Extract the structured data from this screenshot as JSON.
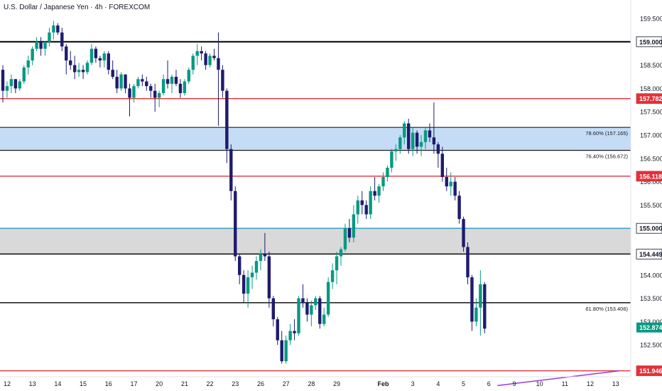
{
  "header": {
    "title": "U.S. Dollar / Japanese Yen · 4h · FOREXCOM"
  },
  "colors": {
    "up": "#089981",
    "down": "#1e1b6e",
    "support_red": "#e0313a",
    "black": "#000000",
    "fib_zone": "#c5dcf6",
    "fib_zone_border": "#1f1f1f",
    "gray_zone": "#d9d9d9",
    "gray_zone_top": "#2a9bb8",
    "trend": "#9b3be0",
    "price_tag": "#089981",
    "axis_text": "#131722"
  },
  "chart_data": {
    "type": "candlestick",
    "timeframe": "4h",
    "instrument": "USDJPY",
    "ylim": [
      151.93,
      159.75
    ],
    "y_ticks": [
      "159.500",
      "159.000",
      "158.500",
      "158.000",
      "157.500",
      "157.000",
      "156.500",
      "156.000",
      "155.500",
      "155.000",
      "154.500",
      "154.000",
      "153.500",
      "153.000",
      "152.500"
    ],
    "x_ticks": [
      {
        "label": "12",
        "idx": 1
      },
      {
        "label": "13",
        "idx": 7
      },
      {
        "label": "14",
        "idx": 13
      },
      {
        "label": "15",
        "idx": 19
      },
      {
        "label": "16",
        "idx": 25
      },
      {
        "label": "17",
        "idx": 31
      },
      {
        "label": "20",
        "idx": 37
      },
      {
        "label": "21",
        "idx": 43
      },
      {
        "label": "22",
        "idx": 49
      },
      {
        "label": "23",
        "idx": 55
      },
      {
        "label": "26",
        "idx": 61
      },
      {
        "label": "27",
        "idx": 67
      },
      {
        "label": "28",
        "idx": 73
      },
      {
        "label": "29",
        "idx": 79
      },
      {
        "label": "Feb",
        "idx": 90
      },
      {
        "label": "3",
        "idx": 97
      },
      {
        "label": "4",
        "idx": 103
      },
      {
        "label": "5",
        "idx": 109
      },
      {
        "label": "6",
        "idx": 115
      },
      {
        "label": "9",
        "idx": 121
      },
      {
        "label": "10",
        "idx": 127
      },
      {
        "label": "11",
        "idx": 133
      },
      {
        "label": "12",
        "idx": 139
      },
      {
        "label": "13",
        "idx": 145
      }
    ],
    "horizontal_levels": [
      {
        "value": 159.0,
        "label": "159.000",
        "color": "black",
        "tag": "white"
      },
      {
        "value": 157.782,
        "label": "157.782",
        "color": "red",
        "tag": "red"
      },
      {
        "value": 156.118,
        "label": "156.118",
        "color": "red",
        "tag": "red"
      },
      {
        "value": 155.0,
        "label": "155.000",
        "color": "teal",
        "tag": "white"
      },
      {
        "value": 154.449,
        "label": "154.449",
        "color": "black",
        "tag": "white"
      },
      {
        "value": 153.406,
        "label": "",
        "color": "black",
        "tag": "none"
      },
      {
        "value": 151.946,
        "label": "151.946",
        "color": "red",
        "tag": "red"
      }
    ],
    "zones": [
      {
        "from": 156.672,
        "to": 157.165,
        "kind": "fib"
      },
      {
        "from": 154.449,
        "to": 155.0,
        "kind": "gray"
      }
    ],
    "fib_labels": [
      {
        "text": "78.60% (157.165)",
        "value": 157.165
      },
      {
        "text": "76.40% (156.672)",
        "value": 156.672
      },
      {
        "text": "61.80% (153.406)",
        "value": 153.406
      }
    ],
    "last_price": "152.874",
    "trendline": [
      {
        "idx": 117,
        "value": 151.75
      },
      {
        "idx": 146,
        "value": 151.946
      }
    ],
    "candles": [
      [
        158.4,
        158.5,
        157.7,
        157.95
      ],
      [
        157.95,
        158.15,
        157.8,
        158.05
      ],
      [
        158.05,
        158.3,
        157.9,
        158.2
      ],
      [
        158.2,
        158.2,
        157.9,
        158.0
      ],
      [
        158.0,
        158.2,
        157.95,
        158.15
      ],
      [
        158.15,
        158.5,
        158.1,
        158.45
      ],
      [
        158.45,
        158.7,
        158.3,
        158.6
      ],
      [
        158.6,
        158.9,
        158.5,
        158.85
      ],
      [
        158.85,
        159.1,
        158.8,
        159.0
      ],
      [
        159.0,
        159.1,
        158.7,
        158.85
      ],
      [
        158.85,
        159.0,
        158.7,
        159.0
      ],
      [
        159.0,
        159.3,
        158.9,
        159.2
      ],
      [
        159.2,
        159.45,
        159.05,
        159.35
      ],
      [
        159.35,
        159.4,
        159.15,
        159.2
      ],
      [
        159.2,
        159.3,
        158.8,
        158.9
      ],
      [
        158.9,
        158.95,
        158.3,
        158.6
      ],
      [
        158.6,
        158.8,
        158.4,
        158.5
      ],
      [
        158.5,
        158.7,
        158.2,
        158.35
      ],
      [
        158.35,
        158.55,
        158.25,
        158.4
      ],
      [
        158.4,
        158.5,
        158.2,
        158.35
      ],
      [
        158.35,
        158.6,
        158.3,
        158.55
      ],
      [
        158.55,
        158.95,
        158.5,
        158.85
      ],
      [
        158.85,
        158.9,
        158.55,
        158.65
      ],
      [
        158.65,
        158.7,
        158.45,
        158.6
      ],
      [
        158.6,
        158.8,
        158.45,
        158.75
      ],
      [
        158.75,
        158.8,
        158.3,
        158.4
      ],
      [
        158.4,
        158.6,
        158.2,
        158.25
      ],
      [
        158.25,
        158.4,
        157.9,
        158.0
      ],
      [
        158.0,
        158.35,
        157.95,
        158.3
      ],
      [
        158.3,
        158.3,
        157.9,
        158.0
      ],
      [
        158.0,
        158.1,
        157.4,
        157.8
      ],
      [
        157.8,
        158.1,
        157.7,
        158.05
      ],
      [
        158.05,
        158.25,
        158.0,
        158.2
      ],
      [
        158.2,
        158.3,
        158.05,
        158.15
      ],
      [
        158.15,
        158.25,
        157.95,
        158.05
      ],
      [
        158.05,
        158.1,
        157.8,
        157.95
      ],
      [
        157.95,
        158.1,
        157.5,
        157.8
      ],
      [
        157.8,
        157.95,
        157.6,
        157.9
      ],
      [
        157.9,
        158.3,
        157.85,
        158.2
      ],
      [
        158.2,
        158.6,
        158.0,
        158.1
      ],
      [
        158.1,
        158.3,
        157.9,
        158.25
      ],
      [
        158.25,
        158.4,
        158.05,
        158.1
      ],
      [
        158.1,
        158.2,
        157.8,
        157.9
      ],
      [
        157.9,
        158.2,
        157.85,
        158.15
      ],
      [
        158.15,
        158.45,
        158.1,
        158.4
      ],
      [
        158.4,
        158.75,
        158.3,
        158.7
      ],
      [
        158.7,
        158.95,
        158.5,
        158.8
      ],
      [
        158.8,
        158.9,
        158.6,
        158.75
      ],
      [
        158.75,
        158.8,
        158.4,
        158.5
      ],
      [
        158.5,
        158.75,
        158.45,
        158.7
      ],
      [
        158.7,
        158.85,
        158.6,
        158.65
      ],
      [
        158.65,
        159.2,
        157.2,
        158.4
      ],
      [
        158.4,
        158.5,
        157.8,
        157.95
      ],
      [
        157.95,
        158.0,
        156.4,
        156.7
      ],
      [
        156.7,
        156.8,
        155.6,
        155.8
      ],
      [
        155.8,
        155.9,
        154.3,
        154.4
      ],
      [
        154.4,
        154.45,
        153.8,
        154.0
      ],
      [
        154.0,
        154.1,
        153.4,
        153.6
      ],
      [
        153.6,
        154.1,
        153.3,
        153.95
      ],
      [
        153.95,
        154.2,
        153.7,
        154.05
      ],
      [
        154.05,
        154.4,
        153.9,
        154.3
      ],
      [
        154.3,
        154.55,
        154.1,
        154.45
      ],
      [
        154.45,
        154.9,
        154.3,
        154.4
      ],
      [
        154.4,
        154.5,
        153.3,
        153.5
      ],
      [
        153.5,
        153.55,
        152.9,
        153.05
      ],
      [
        153.05,
        153.1,
        152.5,
        152.6
      ],
      [
        152.6,
        152.8,
        152.1,
        152.15
      ],
      [
        152.15,
        152.7,
        152.1,
        152.6
      ],
      [
        152.6,
        152.95,
        152.5,
        152.8
      ],
      [
        152.8,
        153.05,
        152.6,
        152.75
      ],
      [
        152.75,
        153.55,
        152.7,
        153.5
      ],
      [
        153.5,
        153.8,
        153.3,
        153.4
      ],
      [
        153.4,
        153.5,
        153.0,
        153.15
      ],
      [
        153.15,
        153.45,
        152.9,
        153.35
      ],
      [
        153.35,
        153.55,
        153.25,
        153.5
      ],
      [
        153.5,
        153.55,
        152.85,
        152.95
      ],
      [
        152.95,
        153.3,
        152.9,
        153.15
      ],
      [
        153.15,
        153.95,
        153.1,
        153.85
      ],
      [
        153.85,
        154.25,
        153.7,
        154.1
      ],
      [
        154.1,
        154.5,
        153.8,
        154.4
      ],
      [
        154.4,
        154.6,
        154.2,
        154.55
      ],
      [
        154.55,
        155.1,
        154.5,
        155.0
      ],
      [
        155.0,
        155.2,
        154.7,
        154.8
      ],
      [
        154.8,
        155.5,
        154.7,
        155.3
      ],
      [
        155.3,
        155.7,
        155.1,
        155.6
      ],
      [
        155.6,
        155.8,
        155.3,
        155.5
      ],
      [
        155.5,
        155.6,
        155.2,
        155.3
      ],
      [
        155.3,
        155.9,
        155.2,
        155.8
      ],
      [
        155.8,
        156.1,
        155.6,
        155.7
      ],
      [
        155.7,
        155.95,
        155.55,
        155.9
      ],
      [
        155.9,
        156.2,
        155.8,
        156.1
      ],
      [
        156.1,
        156.35,
        156.0,
        156.3
      ],
      [
        156.3,
        156.7,
        156.2,
        156.65
      ],
      [
        156.65,
        156.8,
        156.45,
        156.7
      ],
      [
        156.7,
        157.0,
        156.6,
        156.95
      ],
      [
        156.95,
        157.3,
        156.8,
        157.25
      ],
      [
        157.25,
        157.35,
        156.6,
        156.7
      ],
      [
        156.7,
        157.15,
        156.55,
        157.05
      ],
      [
        157.05,
        157.1,
        156.6,
        156.75
      ],
      [
        156.75,
        157.0,
        156.55,
        156.85
      ],
      [
        156.85,
        157.15,
        156.7,
        157.1
      ],
      [
        157.1,
        157.25,
        156.85,
        156.95
      ],
      [
        156.95,
        157.7,
        156.6,
        156.8
      ],
      [
        156.8,
        156.85,
        156.3,
        156.6
      ],
      [
        156.6,
        156.75,
        156.0,
        156.1
      ],
      [
        156.1,
        156.3,
        155.8,
        155.9
      ],
      [
        155.9,
        156.2,
        155.7,
        156.0
      ],
      [
        156.0,
        156.1,
        155.6,
        155.7
      ],
      [
        155.7,
        155.8,
        155.1,
        155.2
      ],
      [
        155.2,
        155.25,
        154.5,
        154.6
      ],
      [
        154.6,
        154.7,
        153.8,
        153.95
      ],
      [
        153.95,
        154.0,
        152.8,
        153.0
      ],
      [
        153.0,
        153.5,
        152.9,
        153.3
      ],
      [
        153.3,
        154.1,
        152.7,
        153.8
      ],
      [
        153.8,
        153.85,
        152.75,
        152.85
      ]
    ]
  }
}
